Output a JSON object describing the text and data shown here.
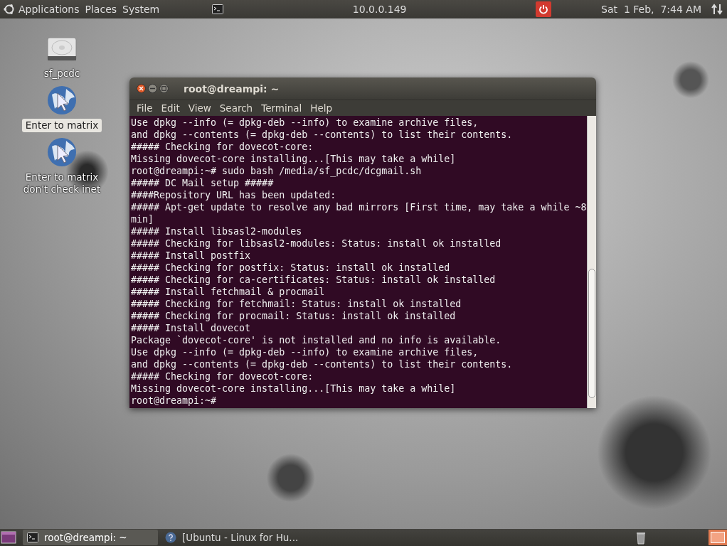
{
  "top_panel": {
    "menus": [
      "Applications",
      "Places",
      "System"
    ],
    "host": "10.0.0.149",
    "clock": "Sat  1 Feb,  7:44 AM"
  },
  "desktop_icons": [
    {
      "kind": "drive",
      "label": "sf_pcdc",
      "selected": false
    },
    {
      "kind": "globe",
      "label": "Enter to matrix",
      "selected": true
    },
    {
      "kind": "globe",
      "label": "Enter to matrix don't check inet",
      "selected": false
    }
  ],
  "terminal": {
    "title": "root@dreampi: ~",
    "menu": [
      "File",
      "Edit",
      "View",
      "Search",
      "Terminal",
      "Help"
    ],
    "lines": [
      "Use dpkg --info (= dpkg-deb --info) to examine archive files,",
      "and dpkg --contents (= dpkg-deb --contents) to list their contents.",
      "##### Checking for dovecot-core:",
      "Missing dovecot-core installing...[This may take a while]",
      "root@dreampi:~# sudo bash /media/sf_pcdc/dcgmail.sh",
      "##### DC Mail setup #####",
      "####Repository URL has been updated:",
      "##### Apt-get update to resolve any bad mirrors [First time, may take a while ~8",
      "min]",
      "##### Install libsasl2-modules",
      "##### Checking for libsasl2-modules: Status: install ok installed",
      "##### Install postfix",
      "##### Checking for postfix: Status: install ok installed",
      "##### Checking for ca-certificates: Status: install ok installed",
      "##### Install fetchmail & procmail",
      "##### Checking for fetchmail: Status: install ok installed",
      "##### Checking for procmail: Status: install ok installed",
      "##### Install dovecot",
      "Package `dovecot-core' is not installed and no info is available.",
      "Use dpkg --info (= dpkg-deb --info) to examine archive files,",
      "and dpkg --contents (= dpkg-deb --contents) to list their contents.",
      "##### Checking for dovecot-core:",
      "Missing dovecot-core installing...[This may take a while]",
      "root@dreampi:~#"
    ]
  },
  "taskbar": {
    "items": [
      {
        "kind": "terminal",
        "label": "root@dreampi: ~",
        "selected": true
      },
      {
        "kind": "help",
        "label": "[Ubuntu - Linux for Hu...",
        "selected": false
      }
    ]
  }
}
